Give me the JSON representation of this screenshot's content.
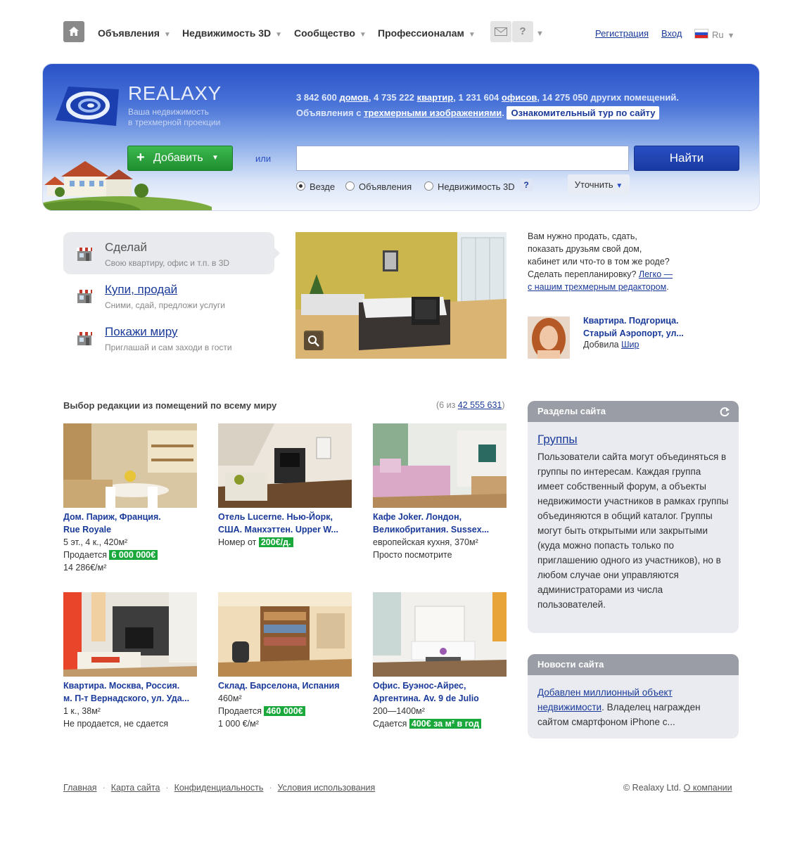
{
  "nav": {
    "items": [
      {
        "label": "Объявления"
      },
      {
        "label": "Недвижимость 3D"
      },
      {
        "label": "Сообщество"
      },
      {
        "label": "Профессионалам"
      }
    ],
    "help": "?",
    "register": "Регистрация",
    "login": "Вход",
    "lang": "Ru"
  },
  "banner": {
    "logo": "REALAXY",
    "tagline1": "Ваша недвижимость",
    "tagline2": "в трехмерной проекции",
    "stats": {
      "houses_n": "3 842 600",
      "houses": "домов",
      "flats_n": "4 735 222",
      "flats": "квартир",
      "offices_n": "1 231 604",
      "offices": "офисов",
      "other": "14 275 050 других помещений."
    },
    "ads_prefix": "Объявления с",
    "ads_link": "трехмерными изображениями",
    "tour": "Ознакомительный тур по сайту",
    "add": "Добавить",
    "or": "или",
    "find": "Найти",
    "radios": [
      "Везде",
      "Объявления",
      "Недвижимость 3D"
    ],
    "help": "?",
    "refine": "Уточнить"
  },
  "features": [
    {
      "title": "Сделай",
      "sub": "Свою квартиру, офис и т.п. в 3D"
    },
    {
      "title": "Купи, продай",
      "sub": "Сними, сдай, предложи услуги"
    },
    {
      "title": "Покажи миру",
      "sub": "Приглашай и сам заходи в гости"
    }
  ],
  "promo": {
    "l1": "Вам нужно продать, сдать,",
    "l2": "показать друзьям свой дом,",
    "l3": "кабинет или что-то в том же роде?",
    "l4": "Сделать  перепланировку?",
    "link1": "Легко —",
    "link2": "с нашим трехмерным редактором",
    "end": "."
  },
  "recent": {
    "title1": "Квартира. Подгорица.",
    "title2": "Старый Аэропорт, ул...",
    "by": "Добвила",
    "user": "Шир"
  },
  "listings": {
    "title": "Выбор редакции из помещений по всему миру",
    "count_prefix": "(6 из",
    "count_link": "42 555 631",
    "count_suffix": ")",
    "cards": [
      {
        "t1": "Дом. Париж, Франция.",
        "t2": "Rue Royale",
        "l1": "5 эт., 4 к., 420м²",
        "l2pre": "Продается",
        "l2price": "6 000 000€",
        "l3": "14 286€/м²"
      },
      {
        "t1": "Отель Lucerne. Нью-Йорк,",
        "t2": "США. Манхэттен. Upper W...",
        "l1pre": "Номер от",
        "l1price": "200€/д."
      },
      {
        "t1": "Кафе Joker. Лондон,",
        "t2": "Великобритания. Sussex...",
        "l1": "европейская кухня, 370м²",
        "l2": "Просто посмотрите"
      },
      {
        "t1": "Квартира. Москва, Россия.",
        "t2": "м. П-т Вернадского, ул. Уда...",
        "l1": "1 к., 38м²",
        "l2": "Не продается, не сдается"
      },
      {
        "t1": "Склад. Барселона, Испания",
        "l1": "460м²",
        "l2pre": "Продается",
        "l2price": "460 000€",
        "l3": "1 000 €/м²"
      },
      {
        "t1": "Офис. Буэнос-Айрес,",
        "t2": "Аргентина. Av. 9 de Julio",
        "l1": "200—1400м²",
        "l2pre": "Сдается",
        "l2price": "400€ за м² в год"
      }
    ]
  },
  "sections_panel": {
    "header": "Разделы сайта",
    "link": "Группы",
    "text": "Пользователи сайта могут объединяться в группы по интересам. Каждая группа имеет собственный форум, а объекты недвижимости участников в рамках группы объединяются в общий каталог. Группы могут быть открытыми или закрытыми (куда можно попасть только по приглашению одного  из участников), но в любом случае они управляются администраторами из числа пользователей."
  },
  "news_panel": {
    "header": "Новости сайта",
    "link1": "Добавлен миллионный объект",
    "link2": "недвижимости",
    "text1": ". Владелец награжден",
    "text2": "сайтом смартфоном iPhone с..."
  },
  "footer": {
    "links": [
      "Главная",
      "Карта сайта",
      "Конфиденциальность",
      "Условия использования"
    ],
    "copy": "© Realaxy Ltd.",
    "about": "О компании"
  },
  "colors": {
    "brand_blue": "#1a3a9a",
    "price_green": "#1aa83c",
    "add_green": "#2aa83e",
    "banner_blue": "#2a52c8"
  }
}
